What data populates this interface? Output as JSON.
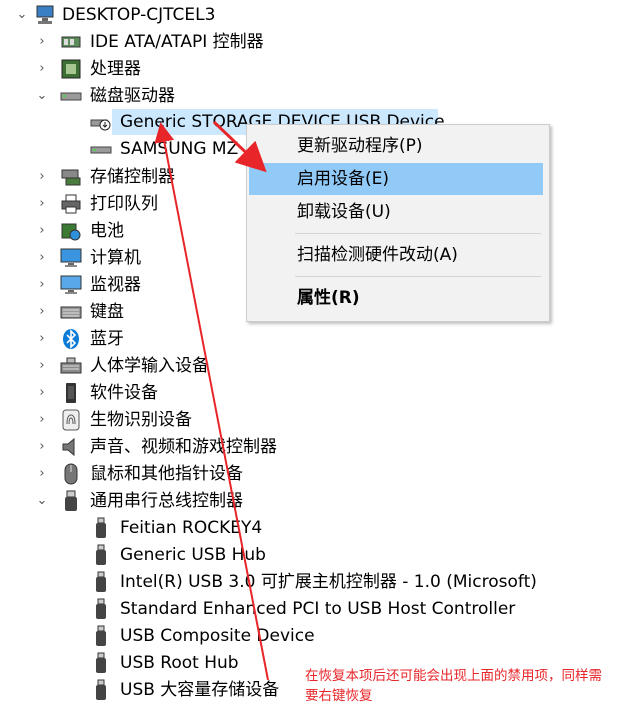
{
  "tree": {
    "root": "DESKTOP-CJTCEL3",
    "categories": [
      {
        "label": "IDE ATA/ATAPI 控制器",
        "icon": "ide-controller-icon"
      },
      {
        "label": "处理器",
        "icon": "processor-icon"
      },
      {
        "label": "磁盘驱动器",
        "icon": "disk-drive-icon"
      },
      {
        "label": "存储控制器",
        "icon": "storage-controller-icon"
      },
      {
        "label": "打印队列",
        "icon": "printer-icon"
      },
      {
        "label": "电池",
        "icon": "battery-icon"
      },
      {
        "label": "计算机",
        "icon": "computer-icon"
      },
      {
        "label": "监视器",
        "icon": "monitor-icon"
      },
      {
        "label": "键盘",
        "icon": "keyboard-icon"
      },
      {
        "label": "蓝牙",
        "icon": "bluetooth-icon"
      },
      {
        "label": "人体学输入设备",
        "icon": "hid-icon"
      },
      {
        "label": "软件设备",
        "icon": "software-device-icon"
      },
      {
        "label": "生物识别设备",
        "icon": "fingerprint-icon"
      },
      {
        "label": "声音、视频和游戏控制器",
        "icon": "speaker-icon"
      },
      {
        "label": "鼠标和其他指针设备",
        "icon": "mouse-icon"
      },
      {
        "label": "通用串行总线控制器",
        "icon": "usb-icon"
      }
    ],
    "disk_children": [
      {
        "label": "Generic STORAGE DEVICE USB Device",
        "icon": "disabled-disk-icon"
      },
      {
        "label": "SAMSUNG MZ",
        "icon": "disk-icon"
      }
    ],
    "usb_children": [
      {
        "label": "Feitian ROCKEY4"
      },
      {
        "label": "Generic USB Hub"
      },
      {
        "label": "Intel(R) USB 3.0 可扩展主机控制器 - 1.0 (Microsoft)"
      },
      {
        "label": "Standard Enhanced PCI to USB Host Controller"
      },
      {
        "label": "USB Composite Device"
      },
      {
        "label": "USB Root Hub"
      },
      {
        "label": "USB 大容量存储设备"
      }
    ]
  },
  "context_menu": {
    "items": [
      {
        "label": "更新驱动程序(P)"
      },
      {
        "label": "启用设备(E)"
      },
      {
        "label": "卸载设备(U)"
      },
      {
        "label": "扫描检测硬件改动(A)"
      },
      {
        "label": "属性(R)"
      }
    ]
  },
  "annotation": {
    "line1": "在恢复本项后还可能会出现上面的禁用项，同样需",
    "line2": "要右键恢复"
  },
  "colors": {
    "selection": "#cce8ff",
    "menu_highlight": "#91c9f7",
    "annotation": "#e8262a"
  }
}
